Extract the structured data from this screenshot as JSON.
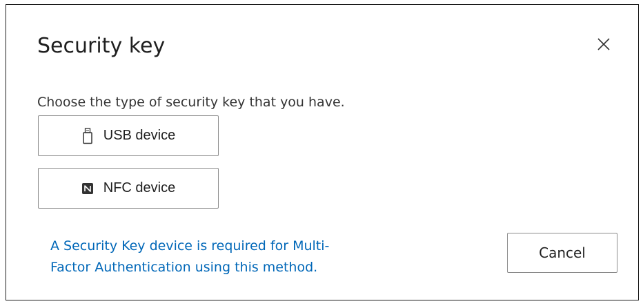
{
  "dialog": {
    "title": "Security key",
    "close_icon": "close-icon",
    "prompt": "Choose the type of security key that you have.",
    "options": [
      {
        "label": "USB device",
        "icon": "usb-drive-icon"
      },
      {
        "label": "NFC device",
        "icon": "nfc-icon"
      }
    ],
    "info_text": "A Security Key device is required for Multi-\nFactor Authentication using this method.",
    "cancel_label": "Cancel"
  },
  "colors": {
    "link_blue": "#0067b8",
    "border": "#8a8a8a",
    "text": "#1f1f1f"
  }
}
